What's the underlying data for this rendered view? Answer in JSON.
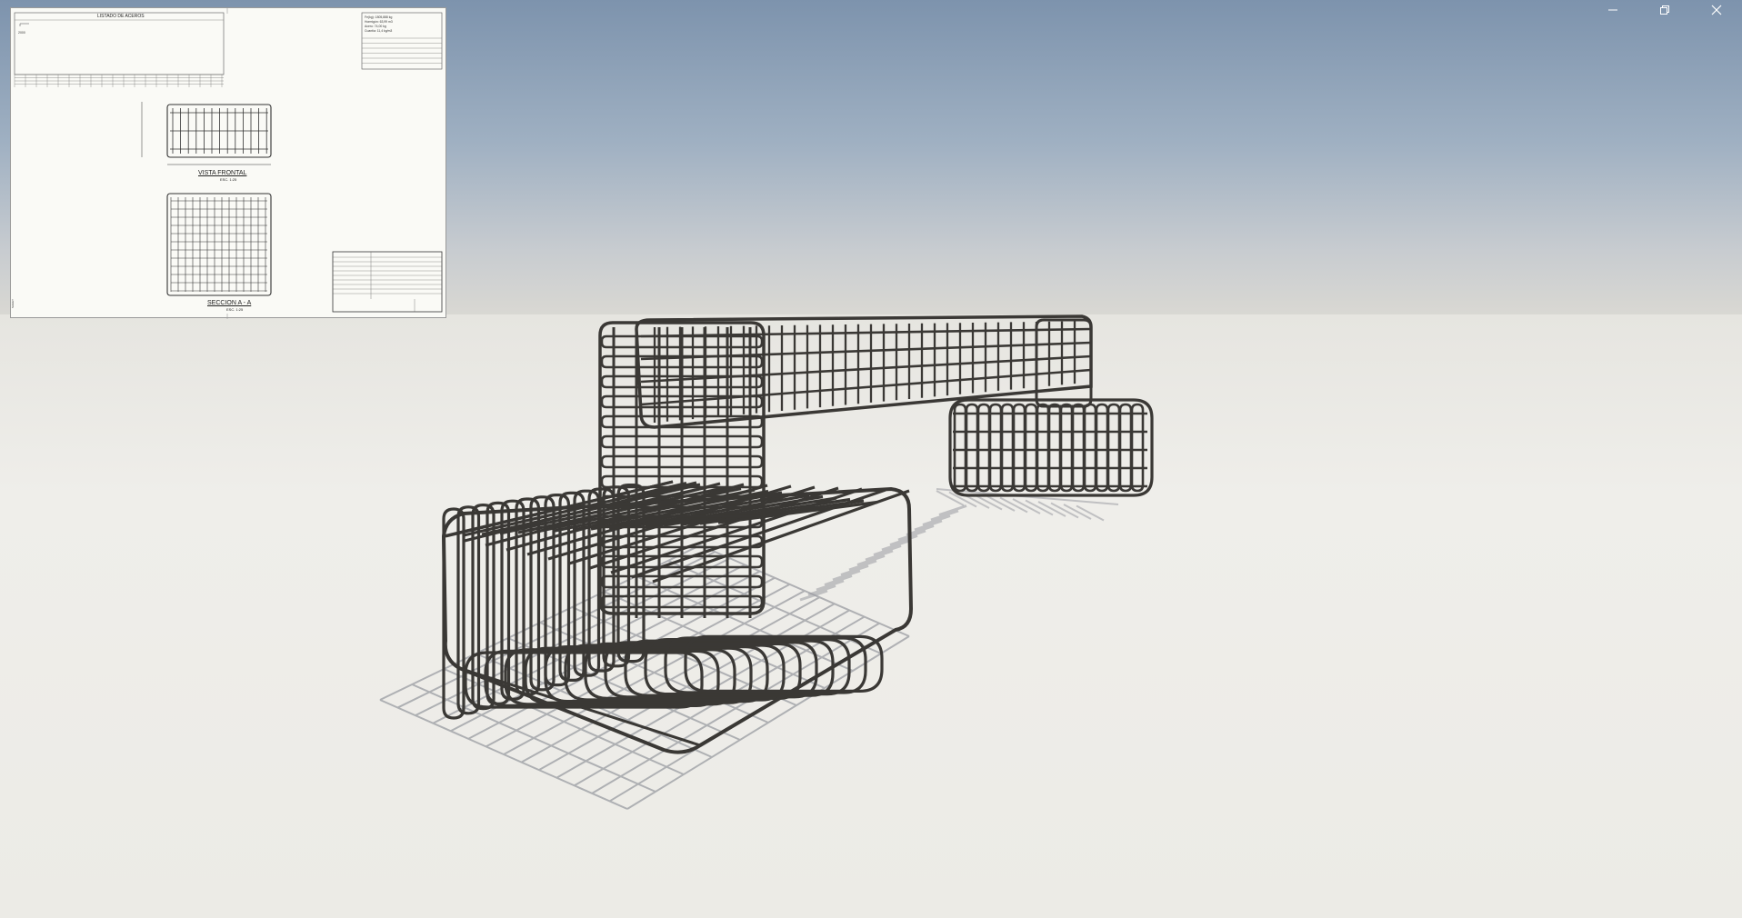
{
  "window": {
    "controls": [
      "minimize",
      "restore",
      "close"
    ]
  },
  "drawing_sheet": {
    "header_title": "LISTADO DE ACEROS",
    "weights_table": {
      "rows": [
        "Fe(kg): 1805,888 kg",
        "Hormigón: 63,99 m3",
        "Acero: 74,00 kg",
        "Cuantía: 11,4 kg/m3"
      ]
    },
    "views": {
      "front_view_title": "VISTA FRONTAL",
      "front_view_scale": "ESC. 1:25",
      "section_title": "SECCION A - A",
      "section_scale": "ESC. 1:25"
    }
  },
  "scene": {
    "subject": "3D rebar cage model (footing, column, beam, small footing)"
  },
  "colors": {
    "sky_top": "#7d93ad",
    "horizon": "#d9d8d3",
    "ground": "#eeeeea",
    "rebar": "#3a3835",
    "shadow": "#9a9ca2"
  }
}
